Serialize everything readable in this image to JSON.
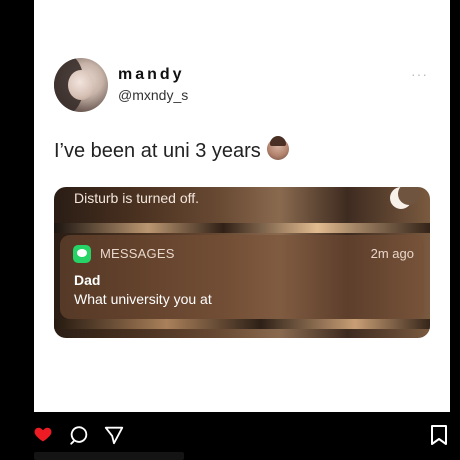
{
  "post": {
    "user": {
      "name": "mandy",
      "handle": "@mxndy_s",
      "more": "···"
    },
    "text": "I’ve been at uni 3 years"
  },
  "notification": {
    "top_text": "Disturb is turned off.",
    "app": "MESSAGES",
    "time": "2m ago",
    "sender": "Dad",
    "message": "What university you at"
  },
  "instagram_actions": {
    "icons": [
      "heart-icon",
      "comment-icon",
      "share-icon",
      "bookmark-icon"
    ],
    "heart_color": "#ed1c24"
  }
}
